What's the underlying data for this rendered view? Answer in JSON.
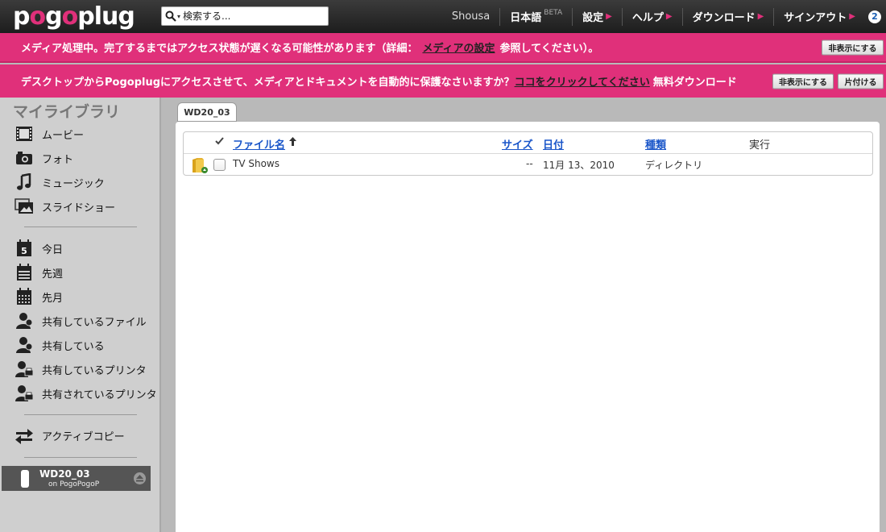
{
  "header": {
    "logo": "pogoplug",
    "search_placeholder": "検索する...",
    "nav": [
      {
        "label": "Shousa"
      },
      {
        "label": "日本語",
        "badge": "BETA"
      },
      {
        "label": "設定"
      },
      {
        "label": "ヘルプ"
      },
      {
        "label": "ダウンロード"
      },
      {
        "label": "サインアウト"
      }
    ],
    "help_badge": "2"
  },
  "banner1": {
    "text": "メディア処理中。完了するまではアクセス状態が遅くなる可能性があります（詳細：",
    "link": "メディアの設定",
    "suffix": "参照してください）。",
    "hide_button": "非表示にする"
  },
  "banner2": {
    "text": "デスクトップからPogoplugにアクセスさせて、メディアとドキュメントを自動的に保護なさいますか？",
    "link": "ココをクリックしてください",
    "suffix": "無料ダウンロード",
    "hide_button": "非表示にする",
    "dismiss_button": "片付ける"
  },
  "sidebar": {
    "title": "マイライブラリ",
    "media": [
      {
        "label": "ムービー",
        "icon": "film-icon"
      },
      {
        "label": "フォト",
        "icon": "camera-icon"
      },
      {
        "label": "ミュージック",
        "icon": "music-note-icon"
      },
      {
        "label": "スライドショー",
        "icon": "slideshow-icon"
      }
    ],
    "time": [
      {
        "label": "今日",
        "icon": "calendar-day-icon",
        "day": "5"
      },
      {
        "label": "先週",
        "icon": "calendar-week-icon"
      },
      {
        "label": "先月",
        "icon": "calendar-month-icon"
      }
    ],
    "shared": [
      {
        "label": "共有しているファイル",
        "icon": "user-share-icon"
      },
      {
        "label": "共有している",
        "icon": "user-share-icon"
      },
      {
        "label": "共有しているプリンタ",
        "icon": "user-printer-icon"
      },
      {
        "label": "共有されているプリンタ",
        "icon": "user-printer-icon"
      }
    ],
    "active_copy": {
      "label": "アクティブコピー",
      "icon": "arrows-swap-icon"
    },
    "device": {
      "name": "WD20_03",
      "sub": "on PogoPogoP"
    }
  },
  "main": {
    "tab": "WD20_03",
    "columns": {
      "name": "ファイル名",
      "size": "サイズ",
      "date": "日付",
      "type": "種類",
      "action": "実行"
    },
    "rows": [
      {
        "name": "TV Shows",
        "size": "--",
        "date": "11月 13、2010",
        "type": "ディレクトリ"
      }
    ]
  },
  "colors": {
    "accent": "#e0307a",
    "link": "#1a56c9",
    "topbar": "#2a2a2a"
  }
}
